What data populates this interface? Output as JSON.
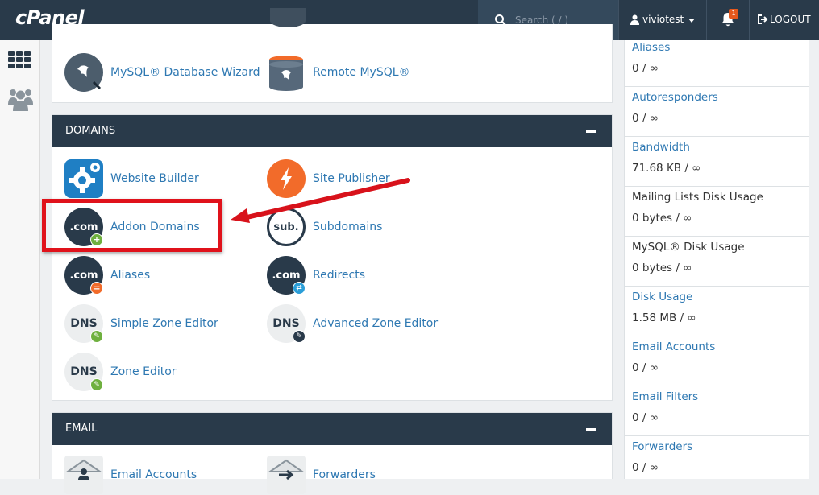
{
  "header": {
    "logo": "cPanel",
    "search_placeholder": "Search ( / )",
    "username": "viviotest",
    "notification_count": "1",
    "logout_label": "LOGOUT"
  },
  "sidebar": {
    "icons": [
      "grid-icon",
      "users-icon"
    ]
  },
  "databases_tail": {
    "apps": [
      {
        "label": "MySQL® Database Wizard",
        "icon": "mysql-wizard-icon"
      },
      {
        "label": "Remote MySQL®",
        "icon": "remote-mysql-icon"
      }
    ]
  },
  "domains": {
    "title": "DOMAINS",
    "apps": [
      {
        "label": "Website Builder",
        "icon": "website-builder-icon"
      },
      {
        "label": "Site Publisher",
        "icon": "site-publisher-icon"
      },
      {
        "label": "Addon Domains",
        "icon": "addon-domains-icon",
        "badge": ".com"
      },
      {
        "label": "Subdomains",
        "icon": "subdomains-icon",
        "badge": "sub."
      },
      {
        "label": "Aliases",
        "icon": "aliases-icon",
        "badge": ".com"
      },
      {
        "label": "Redirects",
        "icon": "redirects-icon",
        "badge": ".com"
      },
      {
        "label": "Simple Zone Editor",
        "icon": "simple-zone-editor-icon",
        "badge": "DNS"
      },
      {
        "label": "Advanced Zone Editor",
        "icon": "advanced-zone-editor-icon",
        "badge": "DNS"
      },
      {
        "label": "Zone Editor",
        "icon": "zone-editor-icon",
        "badge": "DNS"
      }
    ]
  },
  "email": {
    "title": "EMAIL",
    "apps": [
      {
        "label": "Email Accounts",
        "icon": "email-accounts-icon"
      },
      {
        "label": "Forwarders",
        "icon": "forwarders-icon"
      }
    ]
  },
  "stats": [
    {
      "name": "Aliases",
      "value": "0 / ∞",
      "link": true
    },
    {
      "name": "Autoresponders",
      "value": "0 / ∞",
      "link": true
    },
    {
      "name": "Bandwidth",
      "value": "71.68 KB / ∞",
      "link": true
    },
    {
      "name": "Mailing Lists Disk Usage",
      "value": "0 bytes / ∞",
      "link": false
    },
    {
      "name": "MySQL® Disk Usage",
      "value": "0 bytes / ∞",
      "link": false
    },
    {
      "name": "Disk Usage",
      "value": "1.58 MB / ∞",
      "link": true
    },
    {
      "name": "Email Accounts",
      "value": "0 / ∞",
      "link": true
    },
    {
      "name": "Email Filters",
      "value": "0 / ∞",
      "link": true
    },
    {
      "name": "Forwarders",
      "value": "0 / ∞",
      "link": true
    }
  ],
  "colors": {
    "header_bg": "#293a4a",
    "link": "#2e78b2",
    "annotation_red": "#e0121b"
  }
}
